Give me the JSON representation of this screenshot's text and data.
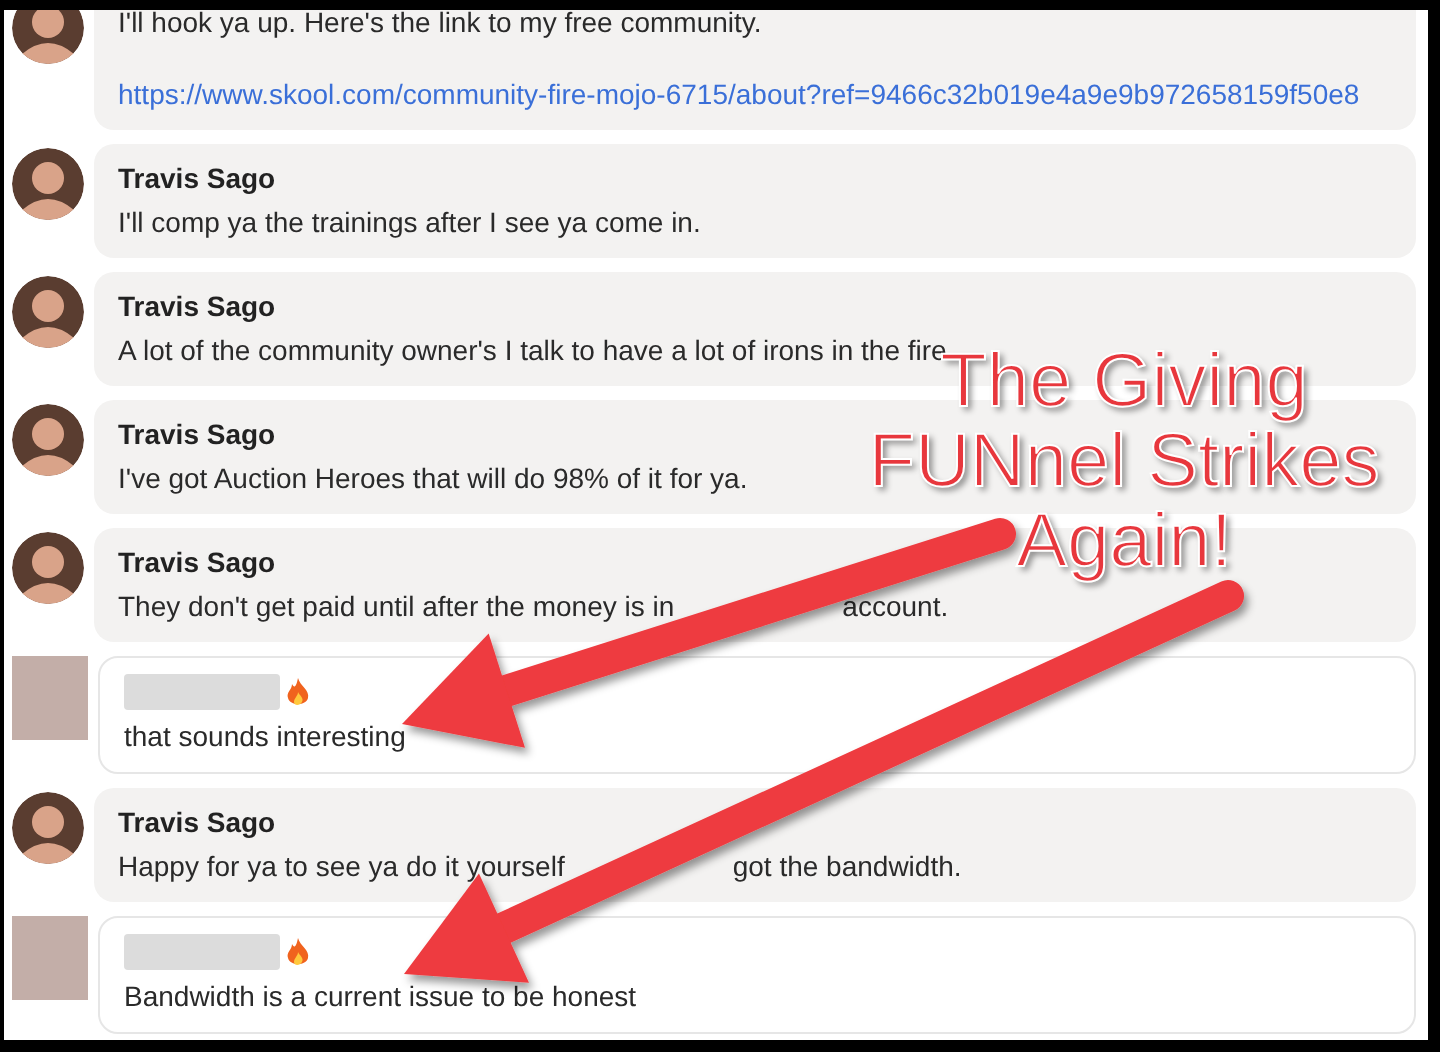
{
  "messages": [
    {
      "kind": "host",
      "text": "I'll hook ya up. Here's the link to my free community.",
      "link": "https://www.skool.com/community-fire-mojo-6715/about?ref=9466c32b019e4a9e9b972658159f50e8"
    },
    {
      "kind": "host",
      "author": "Travis Sago",
      "text": "I'll comp ya the trainings after I see ya come in."
    },
    {
      "kind": "host",
      "author": "Travis Sago",
      "text": "A lot of the community owner's I talk to have a lot of irons in the fire"
    },
    {
      "kind": "host",
      "author": "Travis Sago",
      "text": "I've got Auction Heroes that will do 98% of it for ya."
    },
    {
      "kind": "host",
      "author": "Travis Sago",
      "text": "They don't get paid until after the money is in",
      "text_after": "account."
    },
    {
      "kind": "member",
      "text": "that sounds interesting"
    },
    {
      "kind": "host",
      "author": "Travis Sago",
      "text": "Happy for ya to see ya do it yourself",
      "text_after": "got the bandwidth."
    },
    {
      "kind": "member",
      "text": "Bandwidth is a current issue to be honest"
    }
  ],
  "annotation": {
    "lines": [
      "The Giving",
      "FUNnel Strikes",
      "Again!"
    ]
  }
}
